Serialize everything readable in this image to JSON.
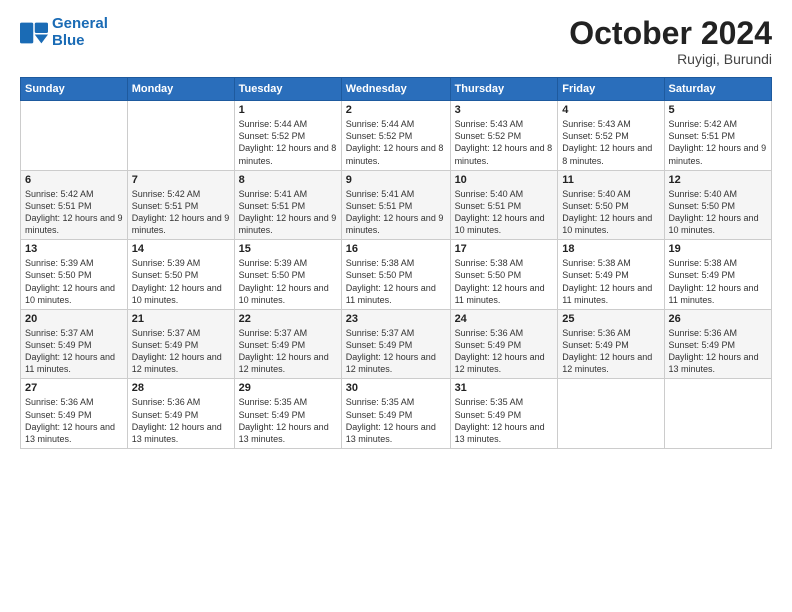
{
  "logo": {
    "line1": "General",
    "line2": "Blue"
  },
  "header": {
    "month": "October 2024",
    "location": "Ruyigi, Burundi"
  },
  "weekdays": [
    "Sunday",
    "Monday",
    "Tuesday",
    "Wednesday",
    "Thursday",
    "Friday",
    "Saturday"
  ],
  "weeks": [
    [
      {
        "day": "",
        "info": ""
      },
      {
        "day": "",
        "info": ""
      },
      {
        "day": "1",
        "info": "Sunrise: 5:44 AM\nSunset: 5:52 PM\nDaylight: 12 hours and 8 minutes."
      },
      {
        "day": "2",
        "info": "Sunrise: 5:44 AM\nSunset: 5:52 PM\nDaylight: 12 hours and 8 minutes."
      },
      {
        "day": "3",
        "info": "Sunrise: 5:43 AM\nSunset: 5:52 PM\nDaylight: 12 hours and 8 minutes."
      },
      {
        "day": "4",
        "info": "Sunrise: 5:43 AM\nSunset: 5:52 PM\nDaylight: 12 hours and 8 minutes."
      },
      {
        "day": "5",
        "info": "Sunrise: 5:42 AM\nSunset: 5:51 PM\nDaylight: 12 hours and 9 minutes."
      }
    ],
    [
      {
        "day": "6",
        "info": "Sunrise: 5:42 AM\nSunset: 5:51 PM\nDaylight: 12 hours and 9 minutes."
      },
      {
        "day": "7",
        "info": "Sunrise: 5:42 AM\nSunset: 5:51 PM\nDaylight: 12 hours and 9 minutes."
      },
      {
        "day": "8",
        "info": "Sunrise: 5:41 AM\nSunset: 5:51 PM\nDaylight: 12 hours and 9 minutes."
      },
      {
        "day": "9",
        "info": "Sunrise: 5:41 AM\nSunset: 5:51 PM\nDaylight: 12 hours and 9 minutes."
      },
      {
        "day": "10",
        "info": "Sunrise: 5:40 AM\nSunset: 5:51 PM\nDaylight: 12 hours and 10 minutes."
      },
      {
        "day": "11",
        "info": "Sunrise: 5:40 AM\nSunset: 5:50 PM\nDaylight: 12 hours and 10 minutes."
      },
      {
        "day": "12",
        "info": "Sunrise: 5:40 AM\nSunset: 5:50 PM\nDaylight: 12 hours and 10 minutes."
      }
    ],
    [
      {
        "day": "13",
        "info": "Sunrise: 5:39 AM\nSunset: 5:50 PM\nDaylight: 12 hours and 10 minutes."
      },
      {
        "day": "14",
        "info": "Sunrise: 5:39 AM\nSunset: 5:50 PM\nDaylight: 12 hours and 10 minutes."
      },
      {
        "day": "15",
        "info": "Sunrise: 5:39 AM\nSunset: 5:50 PM\nDaylight: 12 hours and 10 minutes."
      },
      {
        "day": "16",
        "info": "Sunrise: 5:38 AM\nSunset: 5:50 PM\nDaylight: 12 hours and 11 minutes."
      },
      {
        "day": "17",
        "info": "Sunrise: 5:38 AM\nSunset: 5:50 PM\nDaylight: 12 hours and 11 minutes."
      },
      {
        "day": "18",
        "info": "Sunrise: 5:38 AM\nSunset: 5:49 PM\nDaylight: 12 hours and 11 minutes."
      },
      {
        "day": "19",
        "info": "Sunrise: 5:38 AM\nSunset: 5:49 PM\nDaylight: 12 hours and 11 minutes."
      }
    ],
    [
      {
        "day": "20",
        "info": "Sunrise: 5:37 AM\nSunset: 5:49 PM\nDaylight: 12 hours and 11 minutes."
      },
      {
        "day": "21",
        "info": "Sunrise: 5:37 AM\nSunset: 5:49 PM\nDaylight: 12 hours and 12 minutes."
      },
      {
        "day": "22",
        "info": "Sunrise: 5:37 AM\nSunset: 5:49 PM\nDaylight: 12 hours and 12 minutes."
      },
      {
        "day": "23",
        "info": "Sunrise: 5:37 AM\nSunset: 5:49 PM\nDaylight: 12 hours and 12 minutes."
      },
      {
        "day": "24",
        "info": "Sunrise: 5:36 AM\nSunset: 5:49 PM\nDaylight: 12 hours and 12 minutes."
      },
      {
        "day": "25",
        "info": "Sunrise: 5:36 AM\nSunset: 5:49 PM\nDaylight: 12 hours and 12 minutes."
      },
      {
        "day": "26",
        "info": "Sunrise: 5:36 AM\nSunset: 5:49 PM\nDaylight: 12 hours and 13 minutes."
      }
    ],
    [
      {
        "day": "27",
        "info": "Sunrise: 5:36 AM\nSunset: 5:49 PM\nDaylight: 12 hours and 13 minutes."
      },
      {
        "day": "28",
        "info": "Sunrise: 5:36 AM\nSunset: 5:49 PM\nDaylight: 12 hours and 13 minutes."
      },
      {
        "day": "29",
        "info": "Sunrise: 5:35 AM\nSunset: 5:49 PM\nDaylight: 12 hours and 13 minutes."
      },
      {
        "day": "30",
        "info": "Sunrise: 5:35 AM\nSunset: 5:49 PM\nDaylight: 12 hours and 13 minutes."
      },
      {
        "day": "31",
        "info": "Sunrise: 5:35 AM\nSunset: 5:49 PM\nDaylight: 12 hours and 13 minutes."
      },
      {
        "day": "",
        "info": ""
      },
      {
        "day": "",
        "info": ""
      }
    ]
  ]
}
